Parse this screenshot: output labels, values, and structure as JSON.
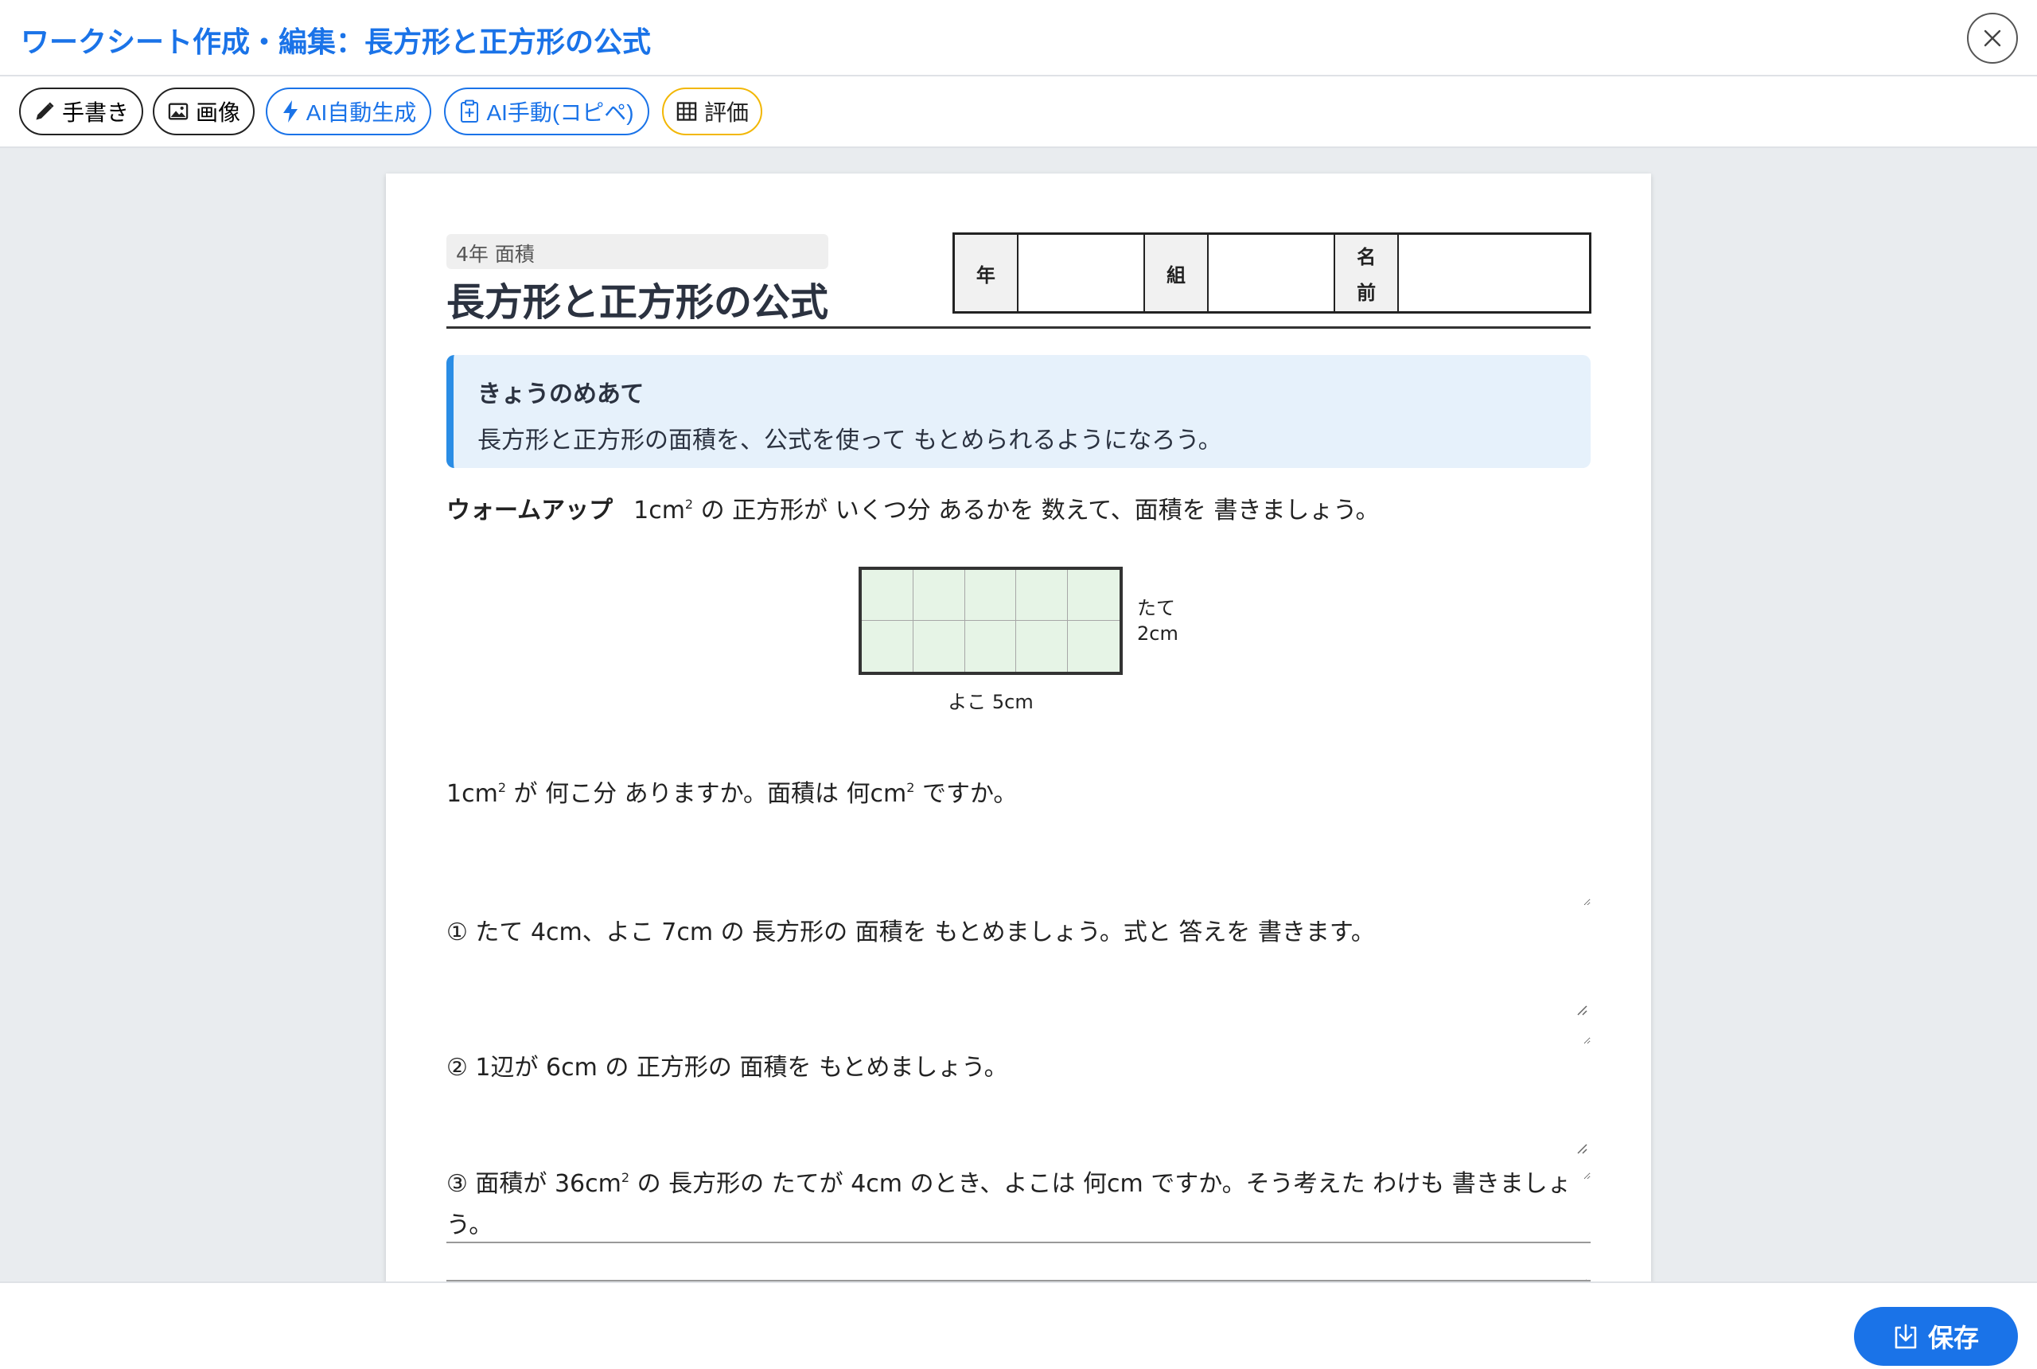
{
  "header": {
    "title": "ワークシート作成・編集：長方形と正方形の公式"
  },
  "toolbar": {
    "handwrite": "手書き",
    "image": "画像",
    "ai_auto": "AI自動生成",
    "ai_manual": "AI手動(コピペ)",
    "evaluate": "評価"
  },
  "worksheet": {
    "subject_tag": "4年 面積",
    "title": "長方形と正方形の公式",
    "name_table": {
      "year_label": "年",
      "class_label": "組",
      "name_label_1": "名",
      "name_label_2": "前"
    },
    "goal": {
      "heading": "きょうのめあて",
      "text": "長方形と正方形の面積を、公式を使って もとめられるようになろう。"
    },
    "warmup": {
      "label": "ウォームアップ",
      "text_1": "1cm",
      "sup": "2",
      "text_2": " の 正方形が いくつ分 あるかを 数えて、面積を 書きましょう。"
    },
    "figure": {
      "height_label_1": "たて",
      "height_label_2": "2cm",
      "width_label": "よこ 5cm",
      "columns": 5,
      "rows": 2
    },
    "q0": {
      "t1": "1cm",
      "sup1": "2",
      "t2": " が 何こ分 ありますか。面積は 何cm",
      "sup2": "2",
      "t3": " ですか。"
    },
    "q1": "① たて 4cm、よこ 7cm の 長方形の 面積を もとめましょう。式と 答えを 書きます。",
    "q2": "② 1辺が 6cm の 正方形の 面積を もとめましょう。",
    "q3": {
      "t1": "③ 面積が 36cm",
      "sup": "2",
      "t2": " の 長方形の たてが 4cm のとき、よこは 何cm ですか。そう考えた わけも 書きましょう。"
    }
  },
  "footer": {
    "save": "保存"
  }
}
